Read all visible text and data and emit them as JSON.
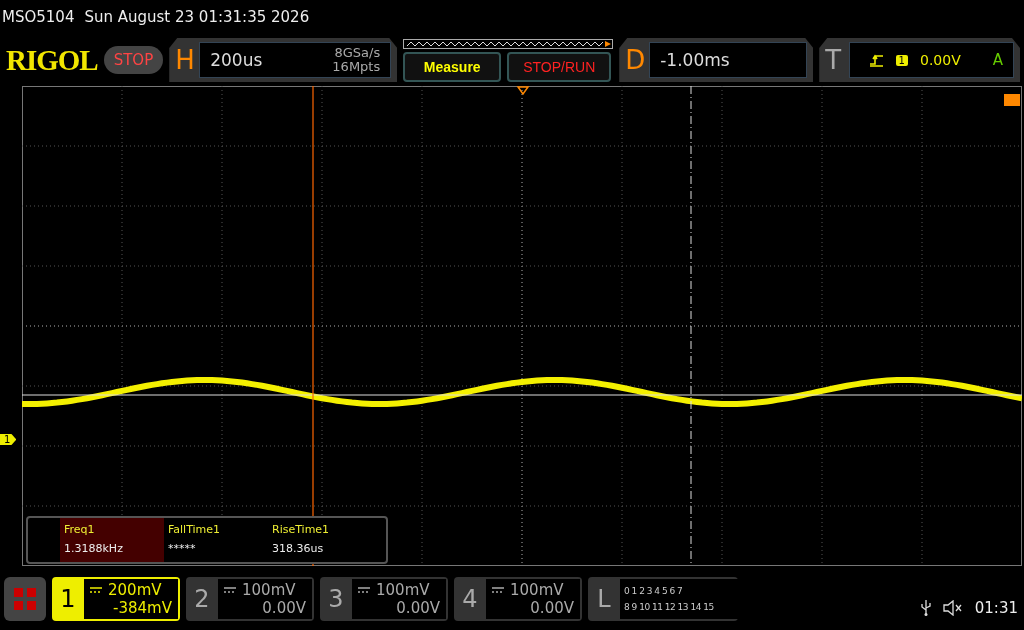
{
  "header": {
    "model": "MSO5104",
    "datetime": "Sun August 23 01:31:35 2026"
  },
  "logo": "RIGOL",
  "run_state": {
    "label": "STOP",
    "running": false
  },
  "horizontal": {
    "label": "H",
    "timebase": "200us",
    "sample_rate": "8GSa/s",
    "memory_depth": "16Mpts"
  },
  "buttons": [
    {
      "label": "Measure",
      "kind": "measure"
    },
    {
      "label": "STOP/RUN",
      "kind": "run"
    }
  ],
  "delay": {
    "label": "D",
    "value": "-1.00ms"
  },
  "trigger": {
    "label": "T",
    "source": "1",
    "level": "0.00V",
    "mode": "A"
  },
  "channel_marker": "1",
  "measurements": [
    {
      "name": "Freq1",
      "value": "1.3188kHz",
      "selected": true
    },
    {
      "name": "FallTime1",
      "value": "*****",
      "selected": false
    },
    {
      "name": "RiseTime1",
      "value": "318.36us",
      "selected": false
    }
  ],
  "channels": [
    {
      "number": "1",
      "scale": "200mV",
      "offset": "-384mV",
      "active": true
    },
    {
      "number": "2",
      "scale": "100mV",
      "offset": "0.00V",
      "active": false
    },
    {
      "number": "3",
      "scale": "100mV",
      "offset": "0.00V",
      "active": false
    },
    {
      "number": "4",
      "scale": "100mV",
      "offset": "0.00V",
      "active": false
    }
  ],
  "logic": {
    "label": "L",
    "row_1": "0 1 2 3 4 5 6 7",
    "row_2": "8 9 10 11 12 13 14 15"
  },
  "status": {
    "time": "01:31"
  }
}
